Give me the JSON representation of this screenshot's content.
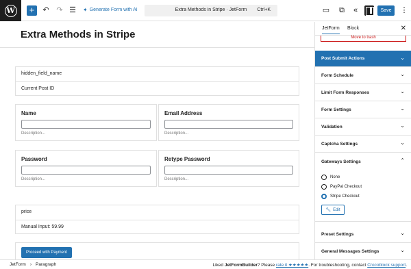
{
  "topbar": {
    "generate_label": "Generate Form with AI",
    "doc_title": "Extra Methods in Stripe · JetForm",
    "shortcut": "Ctrl+K",
    "save_label": "Save",
    "icons": [
      "wordpress-logo",
      "plus",
      "undo",
      "redo",
      "list-view",
      "sparkle",
      "desktop-preview",
      "external-link",
      "collapse",
      "settings-sidebar",
      "more-vertical"
    ]
  },
  "canvas": {
    "page_title": "Extra Methods in Stripe",
    "hidden_block": {
      "name": "hidden_field_name",
      "value": "Current Post ID"
    },
    "fields_row1": [
      {
        "label": "Name",
        "description": "Description..."
      },
      {
        "label": "Email Address",
        "description": "Description..."
      }
    ],
    "fields_row2": [
      {
        "label": "Password",
        "description": "Description..."
      },
      {
        "label": "Retype Password",
        "description": "Description..."
      }
    ],
    "price_block": {
      "name": "price",
      "value": "Manual Input: 59.99"
    },
    "payment_button": "Proceed with Payment"
  },
  "sidebar": {
    "tabs": [
      "JetForm",
      "Block"
    ],
    "trash_label": "Move to trash",
    "panels": {
      "post_submit": "Post Submit Actions",
      "form_schedule": "Form Schedule",
      "limit_responses": "Limit Form Responses",
      "form_settings": "Form Settings",
      "validation": "Validation",
      "captcha": "Captcha Settings",
      "gateways": "Gateways Settings",
      "preset": "Preset Settings",
      "general_messages": "General Messages Settings"
    },
    "gateway_options": [
      "None",
      "PayPal Checkout",
      "Stripe Checkout"
    ],
    "gateway_selected": "Stripe Checkout",
    "edit_label": "Edit"
  },
  "footer": {
    "breadcrumb": [
      "JetForm",
      "Paragraph"
    ],
    "note_prefix": "Liked ",
    "note_brand": "JetFormBuilder",
    "note_mid": "? Please ",
    "note_link1": "rate it ★★★★★",
    "note_mid2": ". For troubleshooting, contact ",
    "note_link2": "Crocoblock support",
    "note_end": "."
  },
  "colors": {
    "accent": "#2271b1",
    "danger": "#cc1818",
    "dark": "#1e1e1e"
  }
}
